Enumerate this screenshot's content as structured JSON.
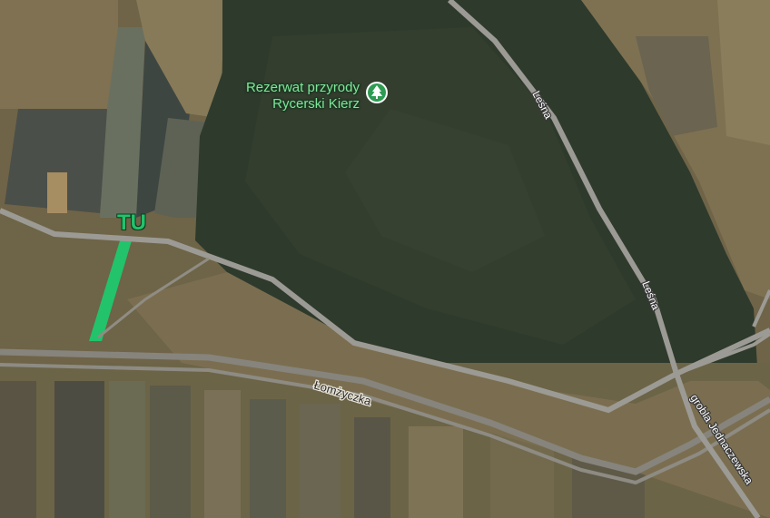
{
  "map": {
    "poi": {
      "name_line1": "Rezerwat przyrody",
      "name_line2": "Rycerski Kierz",
      "icon": "tree-icon",
      "label_color": "#7fe59a"
    },
    "marker_label": "TU",
    "marker_color": "#22c36b",
    "roads": {
      "lesna_upper": "Leśna",
      "lesna_lower": "Leśna",
      "lomzyczka": "Łomżyczka",
      "grobla": "grobla Jednaczewska"
    },
    "colors": {
      "forest": "#2f3a2c",
      "field": "#7a6d4f",
      "road": "#9c9a94",
      "river": "#86847c"
    }
  }
}
